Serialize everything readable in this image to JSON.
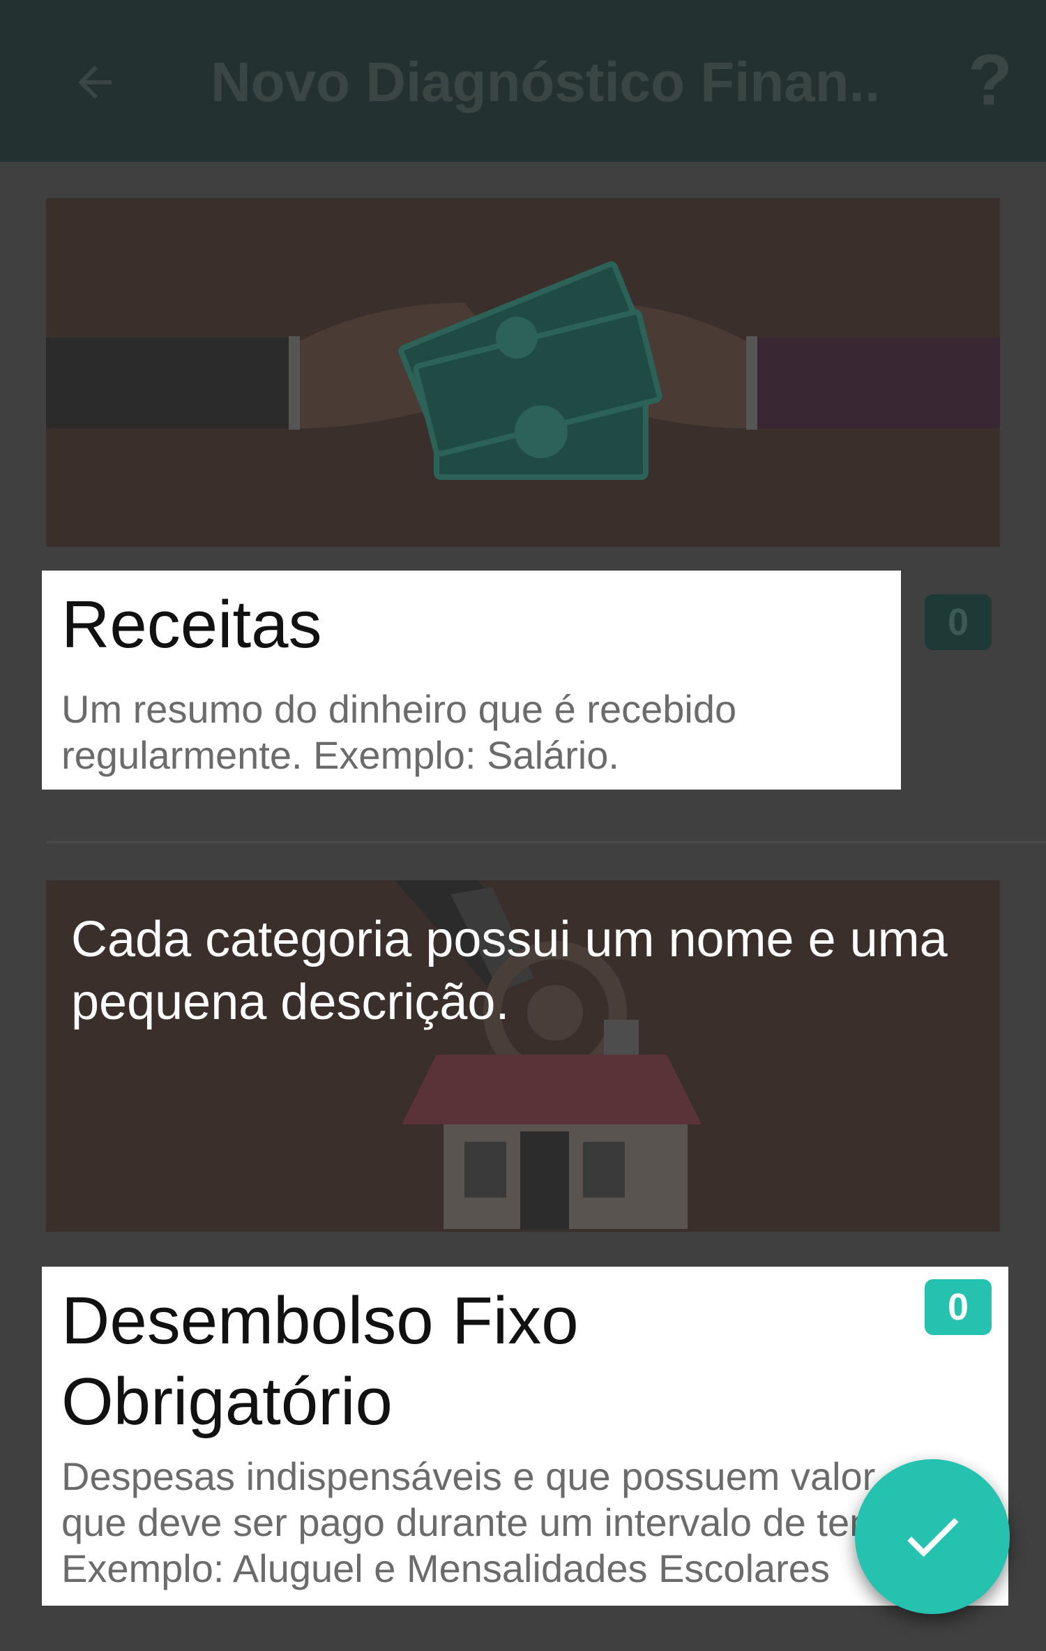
{
  "appbar": {
    "title": "Novo Diagnóstico Finan...",
    "help_label": "?",
    "back_icon": "arrow-left-icon",
    "bg_color": "#233230"
  },
  "categories": [
    {
      "name": "Receitas",
      "description_lines": [
        "Um resumo do dinheiro que é recebido",
        "regularmente. Exemplo: Salário."
      ],
      "count": "0",
      "image": "hands-exchanging-money-illustration"
    },
    {
      "name": "Desembolso Fixo Obrigatório",
      "description_lines": [
        "Despesas indispensáveis e que possuem valor",
        "que deve ser pago durante um intervalo de tempo",
        "Exemplo: Aluguel e Mensalidades Escolares"
      ],
      "count": "0",
      "image": "house-with-coin-illustration"
    }
  ],
  "tooltip": {
    "text": "Cada categoria possui um nome e uma pequena descrição."
  },
  "fab": {
    "icon": "check-icon",
    "color": "#26c2b0"
  }
}
